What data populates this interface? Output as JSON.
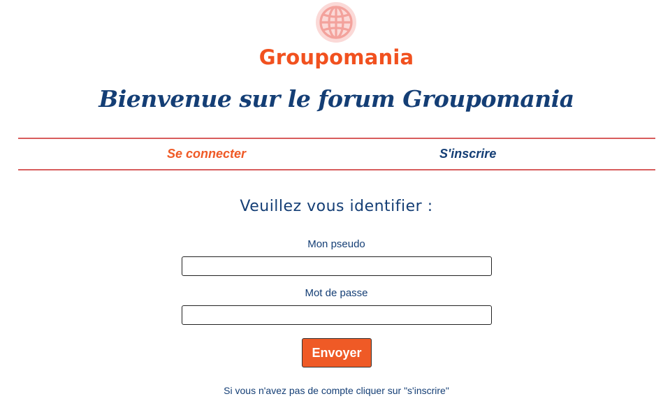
{
  "brand": {
    "logo_icon": "globe-icon",
    "name": "Groupomania",
    "color": "#f1511f"
  },
  "header": {
    "title": "Bienvenue sur le forum Groupomania"
  },
  "tabs": [
    {
      "label": "Se connecter",
      "active": true,
      "color": "#ef5a26"
    },
    {
      "label": "S'inscrire",
      "active": false,
      "color": "#143e75"
    }
  ],
  "login_form": {
    "heading": "Veuillez vous identifier :",
    "pseudo_label": "Mon pseudo",
    "pseudo_value": "",
    "password_label": "Mot de passe",
    "password_value": "",
    "submit_label": "Envoyer",
    "signup_hint": "Si vous n'avez pas de compte cliquer sur \"s'inscrire\""
  },
  "colors": {
    "accent": "#ef5a26",
    "primary_text": "#143e75",
    "divider": "#d85d5d"
  }
}
